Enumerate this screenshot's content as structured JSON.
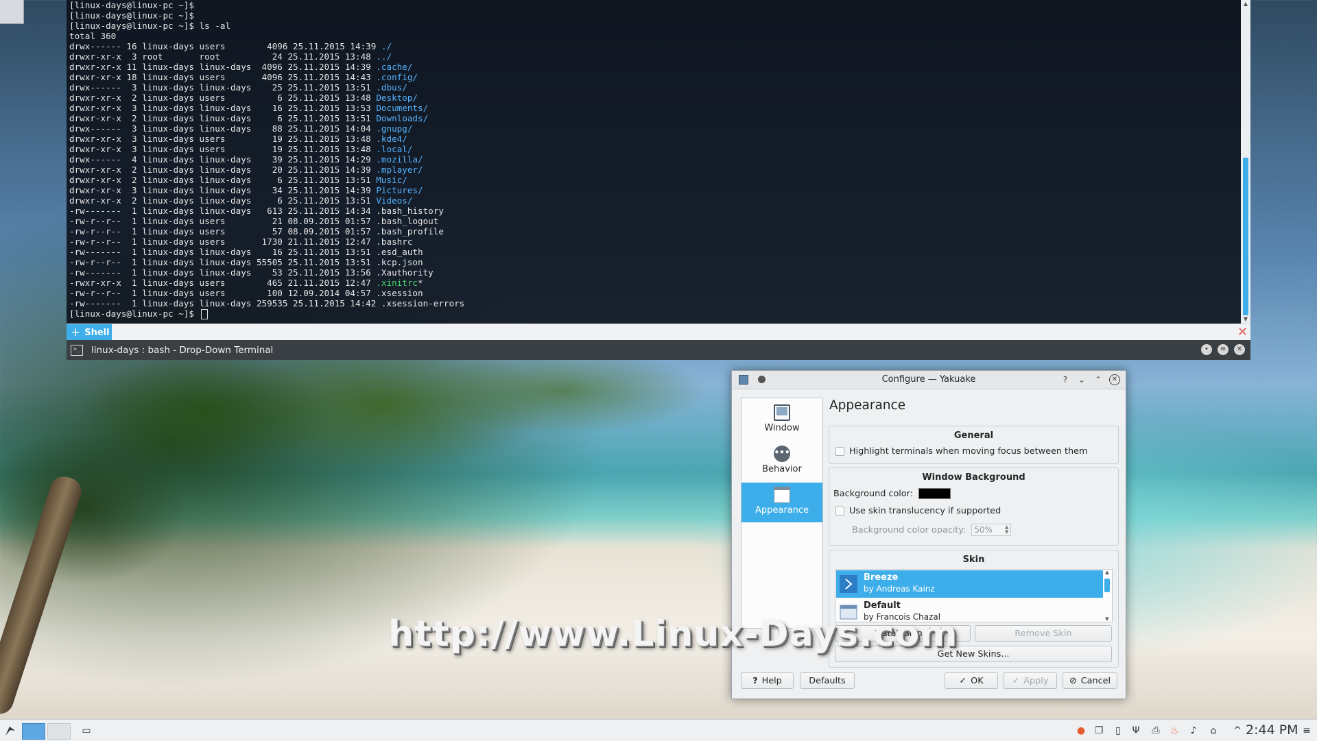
{
  "terminal": {
    "lines": [
      [
        {
          "t": "[linux-days@linux-pc ~]$ "
        }
      ],
      [
        {
          "t": "[linux-days@linux-pc ~]$ "
        }
      ],
      [
        {
          "t": "[linux-days@linux-pc ~]$ ls -al"
        }
      ],
      [
        {
          "t": "total 360"
        }
      ],
      [
        {
          "t": "drwx------ 16 linux-days users        4096 25.11.2015 14:39 "
        },
        {
          "t": "./",
          "c": "dir"
        }
      ],
      [
        {
          "t": "drwxr-xr-x  3 root       root          24 25.11.2015 13:48 "
        },
        {
          "t": "../",
          "c": "dir"
        }
      ],
      [
        {
          "t": "drwxr-xr-x 11 linux-days linux-days  4096 25.11.2015 14:39 "
        },
        {
          "t": ".cache/",
          "c": "dir"
        }
      ],
      [
        {
          "t": "drwxr-xr-x 18 linux-days users       4096 25.11.2015 14:43 "
        },
        {
          "t": ".config/",
          "c": "dir"
        }
      ],
      [
        {
          "t": "drwx------  3 linux-days linux-days    25 25.11.2015 13:51 "
        },
        {
          "t": ".dbus/",
          "c": "dir"
        }
      ],
      [
        {
          "t": "drwxr-xr-x  2 linux-days users          6 25.11.2015 13:48 "
        },
        {
          "t": "Desktop/",
          "c": "dir"
        }
      ],
      [
        {
          "t": "drwxr-xr-x  3 linux-days linux-days    16 25.11.2015 13:53 "
        },
        {
          "t": "Documents/",
          "c": "dir"
        }
      ],
      [
        {
          "t": "drwxr-xr-x  2 linux-days linux-days     6 25.11.2015 13:51 "
        },
        {
          "t": "Downloads/",
          "c": "dir"
        }
      ],
      [
        {
          "t": "drwx------  3 linux-days linux-days    88 25.11.2015 14:04 "
        },
        {
          "t": ".gnupg/",
          "c": "dir"
        }
      ],
      [
        {
          "t": "drwxr-xr-x  3 linux-days users         19 25.11.2015 13:48 "
        },
        {
          "t": ".kde4/",
          "c": "dir"
        }
      ],
      [
        {
          "t": "drwxr-xr-x  3 linux-days users         19 25.11.2015 13:48 "
        },
        {
          "t": ".local/",
          "c": "dir"
        }
      ],
      [
        {
          "t": "drwx------  4 linux-days linux-days    39 25.11.2015 14:29 "
        },
        {
          "t": ".mozilla/",
          "c": "dir"
        }
      ],
      [
        {
          "t": "drwxr-xr-x  2 linux-days linux-days    20 25.11.2015 14:39 "
        },
        {
          "t": ".mplayer/",
          "c": "dir"
        }
      ],
      [
        {
          "t": "drwxr-xr-x  2 linux-days linux-days     6 25.11.2015 13:51 "
        },
        {
          "t": "Music/",
          "c": "dir"
        }
      ],
      [
        {
          "t": "drwxr-xr-x  3 linux-days linux-days    34 25.11.2015 14:39 "
        },
        {
          "t": "Pictures/",
          "c": "dir"
        }
      ],
      [
        {
          "t": "drwxr-xr-x  2 linux-days linux-days     6 25.11.2015 13:51 "
        },
        {
          "t": "Videos/",
          "c": "dir"
        }
      ],
      [
        {
          "t": "-rw-------  1 linux-days linux-days   613 25.11.2015 14:34 .bash_history"
        }
      ],
      [
        {
          "t": "-rw-r--r--  1 linux-days users         21 08.09.2015 01:57 .bash_logout"
        }
      ],
      [
        {
          "t": "-rw-r--r--  1 linux-days users         57 08.09.2015 01:57 .bash_profile"
        }
      ],
      [
        {
          "t": "-rw-r--r--  1 linux-days users       1730 21.11.2015 12:47 .bashrc"
        }
      ],
      [
        {
          "t": "-rw-------  1 linux-days linux-days    16 25.11.2015 13:51 .esd_auth"
        }
      ],
      [
        {
          "t": "-rw-r--r--  1 linux-days linux-days 55505 25.11.2015 13:51 .kcp.json"
        }
      ],
      [
        {
          "t": "-rw-------  1 linux-days linux-days    53 25.11.2015 13:56 .Xauthority"
        }
      ],
      [
        {
          "t": "-rwxr-xr-x  1 linux-days users        465 21.11.2015 12:47 "
        },
        {
          "t": ".xinitrc",
          "c": "exe"
        },
        {
          "t": "*"
        }
      ],
      [
        {
          "t": "-rw-r--r--  1 linux-days users        100 12.09.2014 04:57 .xsession"
        }
      ],
      [
        {
          "t": "-rw-------  1 linux-days linux-days 259535 25.11.2015 14:42 .xsession-errors"
        }
      ],
      [
        {
          "t": "[linux-days@linux-pc ~]$ "
        },
        {
          "cursor": true
        }
      ]
    ],
    "tab_label": "Shell",
    "window_title": "linux-days : bash - Drop-Down Terminal"
  },
  "dialog": {
    "title": "Configure — Yakuake",
    "sidebar": [
      {
        "label": "Window",
        "icon": "window-icon",
        "selected": false
      },
      {
        "label": "Behavior",
        "icon": "behavior-icon",
        "selected": false
      },
      {
        "label": "Appearance",
        "icon": "appearance-icon",
        "selected": true
      }
    ],
    "page_title": "Appearance",
    "general": {
      "title": "General",
      "highlight_label": "Highlight terminals when moving focus between them"
    },
    "window_background": {
      "title": "Window Background",
      "bg_color_label": "Background color:",
      "bg_color": "#000000",
      "translucency_label": "Use skin translucency if supported",
      "opacity_label": "Background color opacity:",
      "opacity_value": "50%"
    },
    "skin": {
      "title": "Skin",
      "items": [
        {
          "name": "Breeze",
          "author": "by Andreas Kainz",
          "selected": true
        },
        {
          "name": "Default",
          "author": "by Francois Chazal",
          "selected": false
        }
      ],
      "install_label": "Install Skin...",
      "remove_label": "Remove Skin",
      "get_new_label": "Get New Skins..."
    },
    "buttons": {
      "help": "Help",
      "defaults": "Defaults",
      "ok": "OK",
      "apply": "Apply",
      "cancel": "Cancel"
    }
  },
  "watermark": "http://www.Linux-Days.com",
  "taskbar": {
    "clock": "2:44 PM"
  },
  "colors": {
    "accent": "#3daee9",
    "terminal_dir": "#55b3ff",
    "terminal_exe": "#46d46b"
  }
}
